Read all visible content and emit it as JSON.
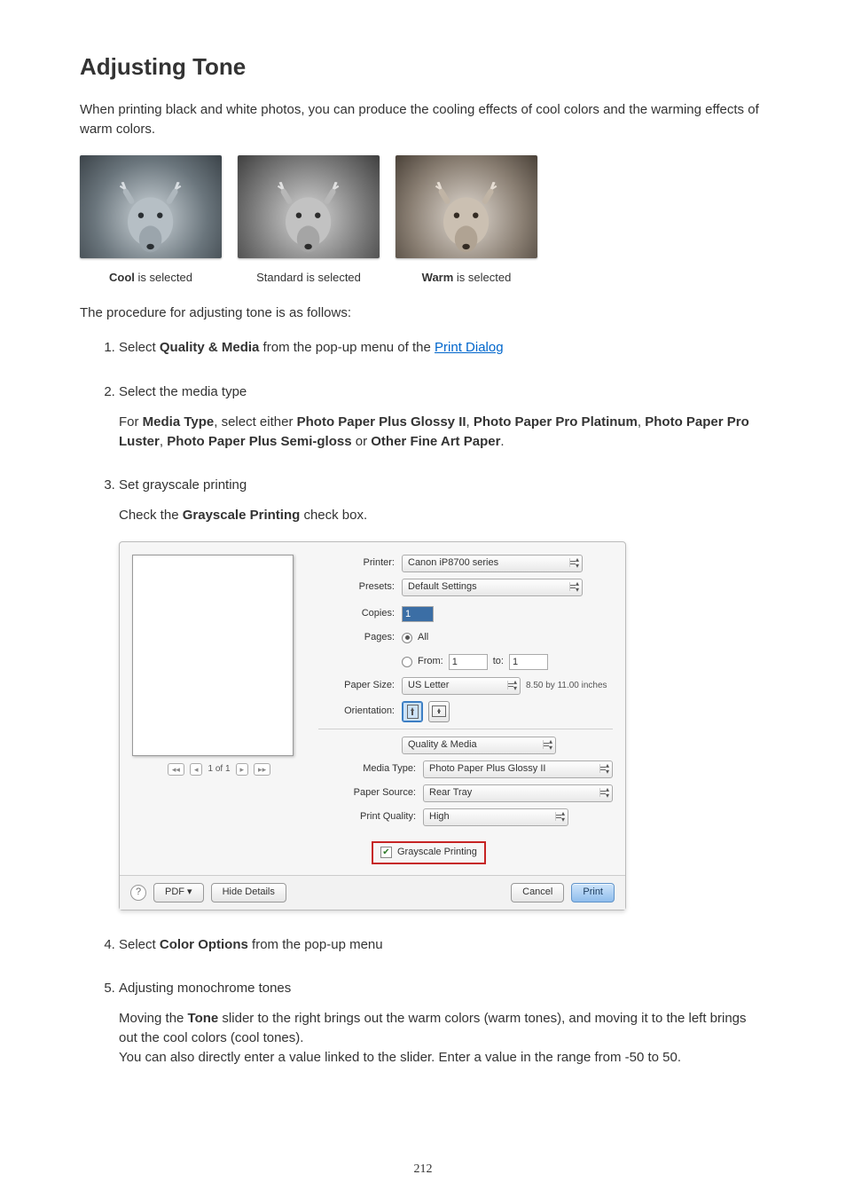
{
  "title": "Adjusting Tone",
  "intro": "When printing black and white photos, you can produce the cooling effects of cool colors and the warming effects of warm colors.",
  "captions": {
    "cool_prefix": "Cool",
    "cool_suffix": " is selected",
    "standard": "Standard is selected",
    "warm_prefix": "Warm",
    "warm_suffix": " is selected"
  },
  "procedure_line": "The procedure for adjusting tone is as follows:",
  "steps": {
    "s1": {
      "t_a": "Select ",
      "t_b": "Quality & Media",
      "t_c": " from the pop-up menu of the ",
      "link": "Print Dialog"
    },
    "s2": {
      "title": "Select the media type",
      "b_a": "For ",
      "b_b": "Media Type",
      "b_c": ", select either ",
      "b_d": "Photo Paper Plus Glossy II",
      "b_e": ", ",
      "b_f": "Photo Paper Pro Platinum",
      "b_g": ", ",
      "b_h": "Photo Paper Pro Luster",
      "b_i": ", ",
      "b_j": "Photo Paper Plus Semi-gloss",
      "b_k": " or ",
      "b_l": "Other Fine Art Paper",
      "b_m": "."
    },
    "s3": {
      "title": "Set grayscale printing",
      "b_a": "Check the ",
      "b_b": "Grayscale Printing",
      "b_c": " check box."
    },
    "s4": {
      "t_a": "Select ",
      "t_b": "Color Options",
      "t_c": " from the pop-up menu"
    },
    "s5": {
      "title": "Adjusting monochrome tones",
      "b_a": "Moving the ",
      "b_b": "Tone",
      "b_c": " slider to the right brings out the warm colors (warm tones), and moving it to the left brings out the cool colors (cool tones).",
      "b_d": "You can also directly enter a value linked to the slider. Enter a value in the range from -50 to 50."
    }
  },
  "dialog": {
    "labels": {
      "printer": "Printer:",
      "presets": "Presets:",
      "copies": "Copies:",
      "pages": "Pages:",
      "all": "All",
      "from": "From:",
      "to": "to:",
      "paper_size": "Paper Size:",
      "orientation": "Orientation:",
      "media_type": "Media Type:",
      "paper_source": "Paper Source:",
      "print_quality": "Print Quality:"
    },
    "values": {
      "printer": "Canon iP8700 series",
      "presets": "Default Settings",
      "copies": "1",
      "from": "1",
      "to": "1",
      "paper_size": "US Letter",
      "paper_dim": "8.50 by 11.00 inches",
      "section_select": "Quality & Media",
      "media_type": "Photo Paper Plus Glossy II",
      "paper_source": "Rear Tray",
      "print_quality": "High",
      "grayscale": "Grayscale Printing",
      "pager": "1 of 1"
    },
    "footer": {
      "pdf": "PDF ▾",
      "hide_details": "Hide Details",
      "cancel": "Cancel",
      "print": "Print"
    }
  },
  "page_number": "212"
}
